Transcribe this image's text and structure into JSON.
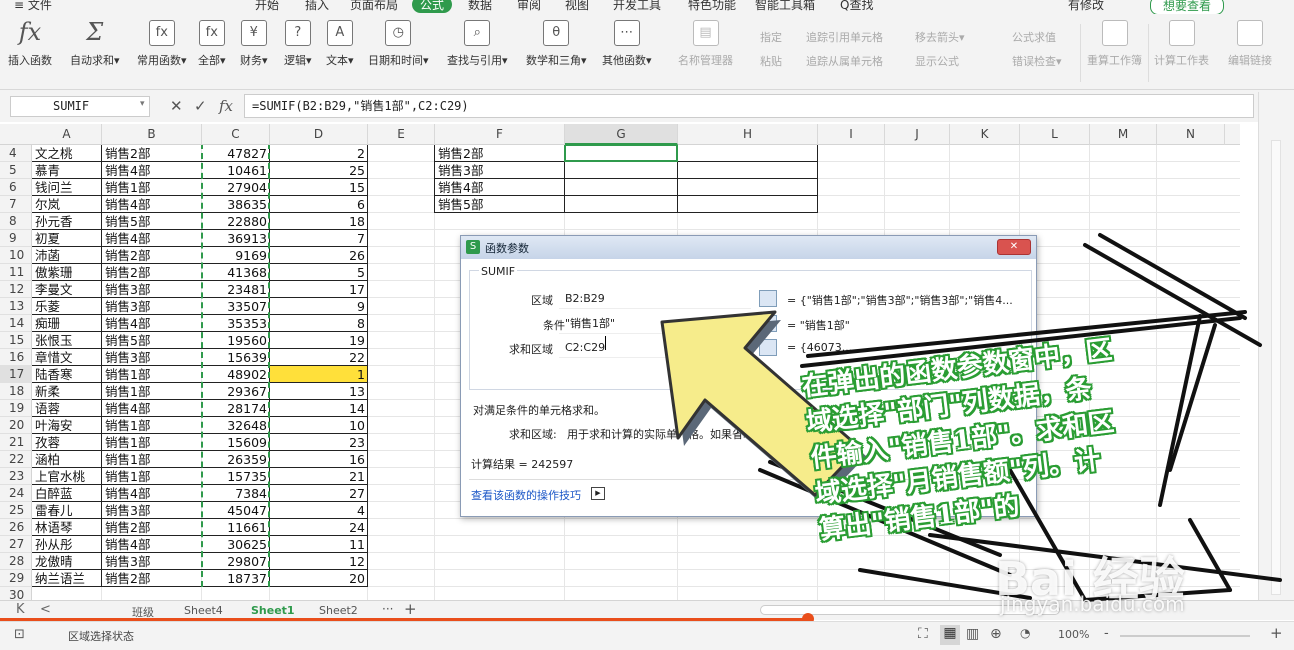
{
  "menu": {
    "items": [
      "≡ 文件",
      "开始",
      "插入",
      "页面布局",
      "公式",
      "数据",
      "审阅",
      "视图",
      "开发工具",
      "特色功能",
      "智能工具箱",
      "Q查找",
      "有修改"
    ],
    "active": "公式",
    "account_btn": "想要查看"
  },
  "ribbon": {
    "groups": [
      {
        "icon": "fx",
        "label": "插入函数"
      },
      {
        "icon": "Σ",
        "label": "自动求和▾"
      },
      {
        "icon": "fx",
        "label": "常用函数▾"
      },
      {
        "icon": "fx",
        "label": "全部▾"
      },
      {
        "icon": "¥",
        "label": "财务▾"
      },
      {
        "icon": "?",
        "label": "逻辑▾"
      },
      {
        "icon": "A",
        "label": "文本▾"
      },
      {
        "icon": "◷",
        "label": "日期和时间▾"
      },
      {
        "icon": "⌕",
        "label": "查找与引用▾"
      },
      {
        "icon": "θ",
        "label": "数学和三角▾"
      },
      {
        "icon": "⋯",
        "label": "其他函数▾"
      },
      {
        "icon": "▤",
        "label": "名称管理器"
      }
    ],
    "small": [
      "指定",
      "粘贴",
      "追踪引用单元格",
      "追踪从属单元格",
      "移去箭头▾",
      "显示公式",
      "公式求值",
      "错误检查▾"
    ],
    "right": [
      "重算工作簿",
      "计算工作表",
      "编辑链接"
    ]
  },
  "formula_bar": {
    "name_box": "SUMIF",
    "formula": "=SUMIF(B2:B29,\"销售1部\",C2:C29)",
    "cancel": "✕",
    "enter": "✓",
    "fx": "fx"
  },
  "columns": [
    "A",
    "B",
    "C",
    "D",
    "E",
    "F",
    "G",
    "H",
    "I",
    "J",
    "K",
    "L",
    "M",
    "N"
  ],
  "rows": [
    {
      "n": "4",
      "a": "文之桃",
      "b": "销售2部",
      "c": "47827",
      "d": "2"
    },
    {
      "n": "5",
      "a": "慕青",
      "b": "销售4部",
      "c": "10461",
      "d": "25"
    },
    {
      "n": "6",
      "a": "钱问兰",
      "b": "销售1部",
      "c": "27904",
      "d": "15"
    },
    {
      "n": "7",
      "a": "尔岚",
      "b": "销售4部",
      "c": "38635",
      "d": "6"
    },
    {
      "n": "8",
      "a": "孙元香",
      "b": "销售5部",
      "c": "22880",
      "d": "18"
    },
    {
      "n": "9",
      "a": "初夏",
      "b": "销售4部",
      "c": "36913",
      "d": "7"
    },
    {
      "n": "10",
      "a": "沛菡",
      "b": "销售2部",
      "c": "9169",
      "d": "26"
    },
    {
      "n": "11",
      "a": "傲紫珊",
      "b": "销售2部",
      "c": "41368",
      "d": "5"
    },
    {
      "n": "12",
      "a": "李曼文",
      "b": "销售3部",
      "c": "23481",
      "d": "17"
    },
    {
      "n": "13",
      "a": "乐菱",
      "b": "销售3部",
      "c": "33507",
      "d": "9"
    },
    {
      "n": "14",
      "a": "痴珊",
      "b": "销售4部",
      "c": "35353",
      "d": "8"
    },
    {
      "n": "15",
      "a": "张恨玉",
      "b": "销售5部",
      "c": "19560",
      "d": "19"
    },
    {
      "n": "16",
      "a": "章惜文",
      "b": "销售3部",
      "c": "15639",
      "d": "22"
    },
    {
      "n": "17",
      "a": "陆香寒",
      "b": "销售1部",
      "c": "48902",
      "d": "1"
    },
    {
      "n": "18",
      "a": "新柔",
      "b": "销售1部",
      "c": "29367",
      "d": "13"
    },
    {
      "n": "19",
      "a": "语蓉",
      "b": "销售4部",
      "c": "28174",
      "d": "14"
    },
    {
      "n": "20",
      "a": "叶海安",
      "b": "销售1部",
      "c": "32648",
      "d": "10"
    },
    {
      "n": "21",
      "a": "孜蓉",
      "b": "销售1部",
      "c": "15609",
      "d": "23"
    },
    {
      "n": "22",
      "a": "涵柏",
      "b": "销售1部",
      "c": "26359",
      "d": "16"
    },
    {
      "n": "23",
      "a": "上官水桃",
      "b": "销售1部",
      "c": "15735",
      "d": "21"
    },
    {
      "n": "24",
      "a": "白醉蓝",
      "b": "销售4部",
      "c": "7384",
      "d": "27"
    },
    {
      "n": "25",
      "a": "雷春儿",
      "b": "销售3部",
      "c": "45047",
      "d": "4"
    },
    {
      "n": "26",
      "a": "林语琴",
      "b": "销售2部",
      "c": "11661",
      "d": "24"
    },
    {
      "n": "27",
      "a": "孙从彤",
      "b": "销售4部",
      "c": "30625",
      "d": "11"
    },
    {
      "n": "28",
      "a": "龙傲晴",
      "b": "销售3部",
      "c": "29807",
      "d": "12"
    },
    {
      "n": "29",
      "a": "纳兰语兰",
      "b": "销售2部",
      "c": "18737",
      "d": "20"
    },
    {
      "n": "30",
      "a": "",
      "b": "",
      "c": "",
      "d": ""
    }
  ],
  "summary_f": [
    "销售2部",
    "销售3部",
    "销售4部",
    "销售5部"
  ],
  "dialog": {
    "title": "函数参数",
    "func": "SUMIF",
    "args": [
      {
        "label": "区域",
        "value": "B2:B29",
        "result": "= {\"销售1部\";\"销售3部\";\"销售3部\";\"销售4..."
      },
      {
        "label": "条件",
        "value": "\"销售1部\"",
        "result": "= \"销售1部\""
      },
      {
        "label": "求和区域",
        "value": "C2:C29",
        "result": "= {46073..."
      }
    ],
    "description": "对满足条件的单元格求和。",
    "param_label": "求和区域:",
    "param_desc": "用于求和计算的实际单元格。如果省略",
    "calc_result": "计算结果 = 242597",
    "help_link": "查看该函数的操作技巧",
    "close": "✕"
  },
  "tabs": {
    "items": [
      "班级",
      "Sheet4",
      "Sheet1",
      "Sheet2"
    ],
    "active": "Sheet1",
    "more": "···",
    "add": "+"
  },
  "status": {
    "text": "区域选择状态",
    "zoom": "100%"
  },
  "annotation": {
    "lines": [
      "在弹出的函数参数窗中，区",
      "域选择\"部门\"列数据，条",
      "件输入\"销售1部\"。求和区",
      "域选择\"月销售额\"列。计",
      "算出\"销售1部\"的"
    ]
  },
  "watermark": {
    "brand": "Bai 经验",
    "url": "jingyan.baidu.com"
  },
  "colors": {
    "accent": "#2f9a4c",
    "highlight": "#ffe03a",
    "progress": "#e94e1b",
    "annotation_green": "#2a9d33",
    "arrow_fill": "#f6ec8b"
  }
}
